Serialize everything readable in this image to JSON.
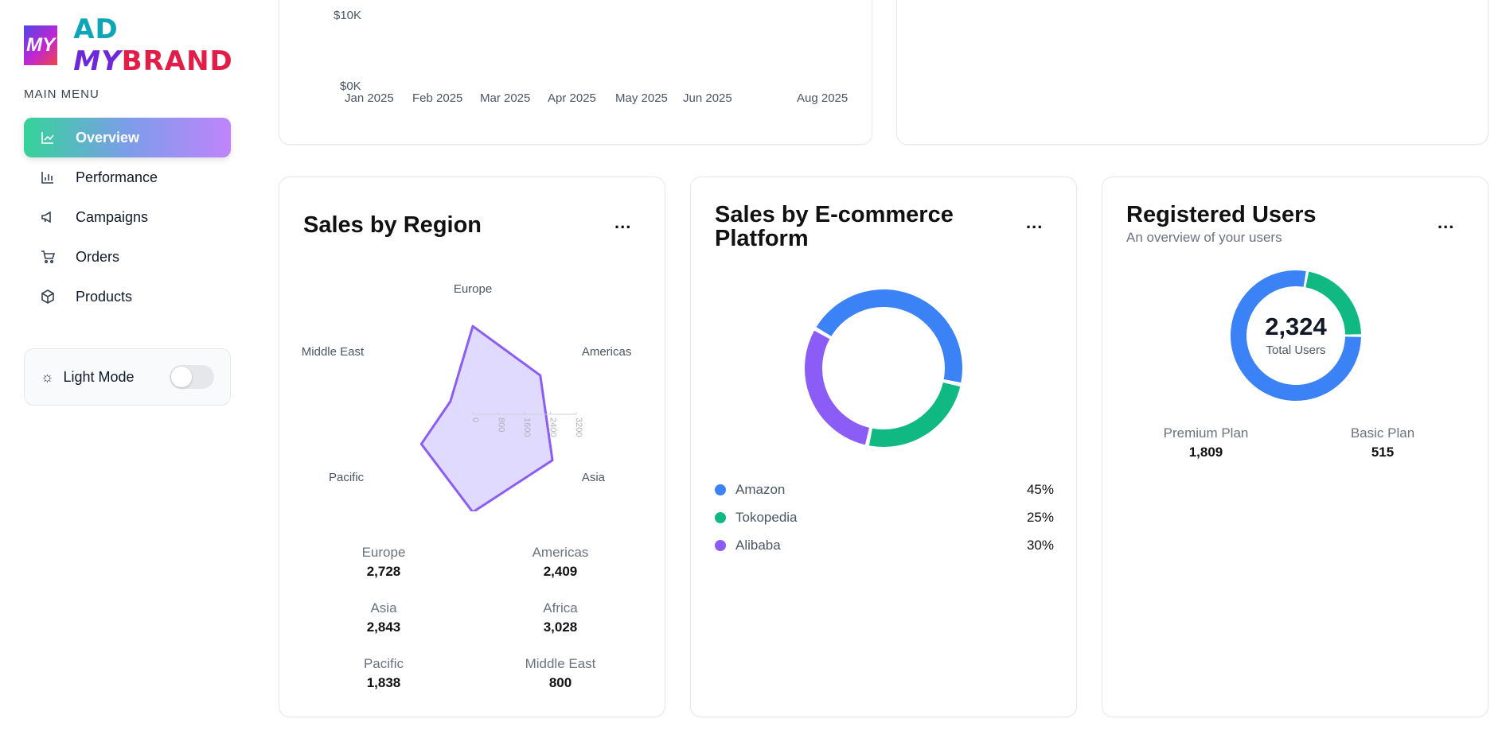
{
  "sidebar": {
    "logo_mark": "MY",
    "logo_text": {
      "a": "AD ",
      "m": "MY",
      "b": "BRAND"
    },
    "menu_title": "MAIN MENU",
    "items": [
      {
        "label": "Overview",
        "icon": "line-chart-icon"
      },
      {
        "label": "Performance",
        "icon": "bar-chart-icon"
      },
      {
        "label": "Campaigns",
        "icon": "megaphone-icon"
      },
      {
        "label": "Orders",
        "icon": "cart-icon"
      },
      {
        "label": "Products",
        "icon": "package-icon"
      }
    ],
    "mode_label": "Light Mode"
  },
  "revenue_chart_partial": {
    "y_ticks": [
      "$10K",
      "$0K"
    ],
    "x_ticks": [
      "Jan 2025",
      "Feb 2025",
      "Mar 2025",
      "Apr 2025",
      "May 2025",
      "Jun 2025",
      "Aug 2025"
    ]
  },
  "region_card": {
    "title": "Sales by Region",
    "menu": "...",
    "stats": [
      {
        "label": "Europe",
        "value": "2,728"
      },
      {
        "label": "Americas",
        "value": "2,409"
      },
      {
        "label": "Asia",
        "value": "2,843"
      },
      {
        "label": "Africa",
        "value": "3,028"
      },
      {
        "label": "Pacific",
        "value": "1,838"
      },
      {
        "label": "Middle East",
        "value": "800"
      }
    ]
  },
  "ecommerce_card": {
    "title_line1": "Sales by E-commerce",
    "title_line2": "Platform",
    "menu": "...",
    "legend": [
      {
        "name": "Amazon",
        "pct": "45%"
      },
      {
        "name": "Tokopedia",
        "pct": "25%"
      },
      {
        "name": "Alibaba",
        "pct": "30%"
      }
    ]
  },
  "users_card": {
    "title": "Registered Users",
    "subtitle": "An overview of your users",
    "menu": "...",
    "total": "2,324",
    "total_label": "Total Users",
    "plans": [
      {
        "label": "Premium Plan",
        "value": "1,809"
      },
      {
        "label": "Basic Plan",
        "value": "515"
      }
    ]
  },
  "colors": {
    "blue": "#3b82f6",
    "green": "#10b981",
    "purple": "#8b5cf6",
    "radar_fill": "#ddd6fe"
  },
  "chart_data": [
    {
      "type": "radar",
      "title": "Sales by Region",
      "categories": [
        "Europe",
        "Americas",
        "Asia",
        "Africa",
        "Pacific",
        "Middle East"
      ],
      "values": [
        2728,
        2409,
        2843,
        3028,
        1838,
        800
      ],
      "radial_ticks": [
        "0",
        "800",
        "1600",
        "2400",
        "3200"
      ],
      "rmax": 3200
    },
    {
      "type": "pie",
      "title": "Sales by E-commerce Platform",
      "categories": [
        "Amazon",
        "Tokopedia",
        "Alibaba"
      ],
      "values": [
        45,
        25,
        30
      ]
    },
    {
      "type": "pie",
      "title": "Registered Users",
      "categories": [
        "Premium Plan",
        "Basic Plan"
      ],
      "values": [
        1809,
        515
      ]
    }
  ]
}
